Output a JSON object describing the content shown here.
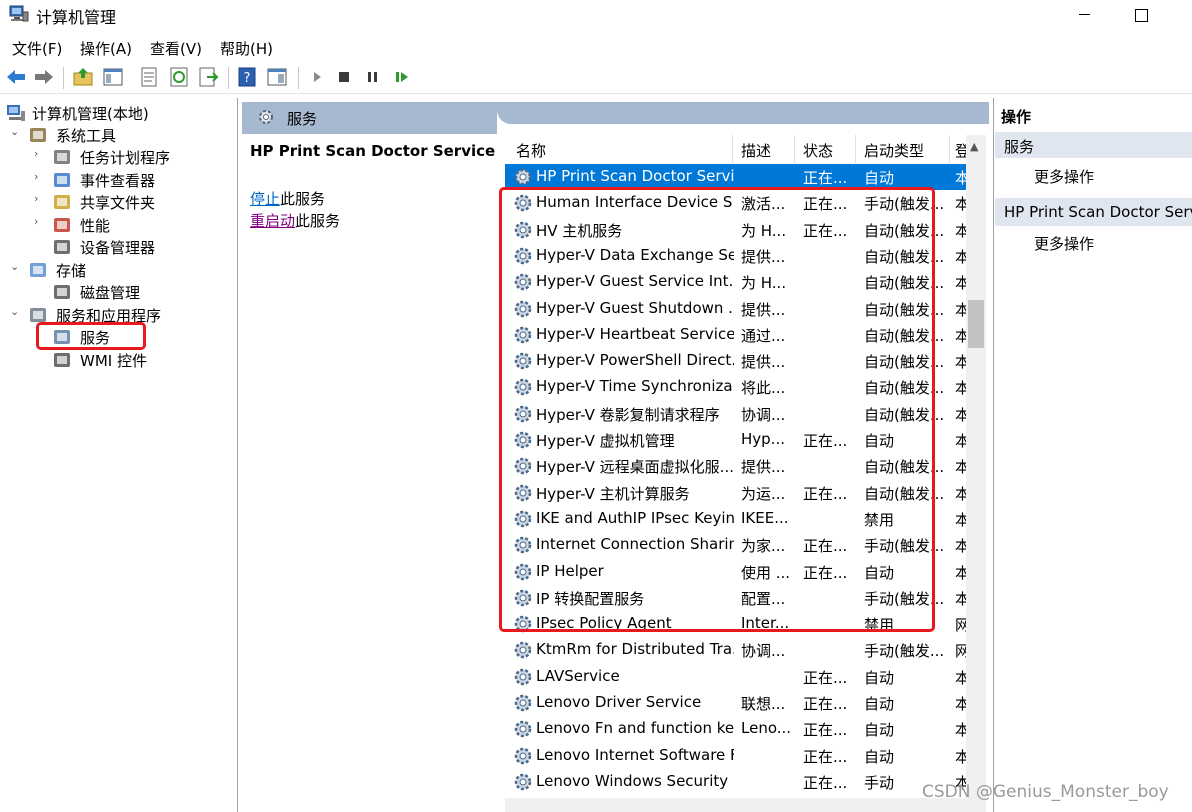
{
  "window": {
    "title": "计算机管理"
  },
  "menu": [
    "文件(F)",
    "操作(A)",
    "查看(V)",
    "帮助(H)"
  ],
  "toolbar_icons": [
    "back-arrow-icon",
    "forward-arrow-icon",
    "up-folder-icon",
    "show-tree-icon",
    "properties-icon",
    "refresh-icon",
    "export-icon",
    "help-icon",
    "action-pane-icon",
    "start-icon",
    "stop-icon",
    "pause-icon",
    "restart-icon"
  ],
  "tree": {
    "root": "计算机管理(本地)",
    "nodes": [
      {
        "label": "系统工具",
        "level": 1,
        "chev": "⌄"
      },
      {
        "label": "任务计划程序",
        "level": 2,
        "chev": "›"
      },
      {
        "label": "事件查看器",
        "level": 2,
        "chev": "›"
      },
      {
        "label": "共享文件夹",
        "level": 2,
        "chev": "›"
      },
      {
        "label": "性能",
        "level": 2,
        "chev": "›"
      },
      {
        "label": "设备管理器",
        "level": 2,
        "chev": ""
      },
      {
        "label": "存储",
        "level": 1,
        "chev": "⌄"
      },
      {
        "label": "磁盘管理",
        "level": 2,
        "chev": ""
      },
      {
        "label": "服务和应用程序",
        "level": 1,
        "chev": "⌄"
      },
      {
        "label": "服务",
        "level": 2,
        "chev": ""
      },
      {
        "label": "WMI 控件",
        "level": 2,
        "chev": ""
      }
    ]
  },
  "services_panel": {
    "header": "服务",
    "selected_name": "HP Print Scan Doctor Service",
    "stop_link": "停止",
    "stop_suffix": "此服务",
    "restart_link": "重启动",
    "restart_suffix": "此服务"
  },
  "columns": [
    "名称",
    "描述",
    "状态",
    "启动类型",
    "登"
  ],
  "rows": [
    [
      "HP Print Scan Doctor Service",
      "",
      "正在...",
      "自动",
      "本"
    ],
    [
      "Human Interface Device S...",
      "激活...",
      "正在...",
      "手动(触发...",
      "本"
    ],
    [
      "HV 主机服务",
      "为 H...",
      "正在...",
      "自动(触发...",
      "本"
    ],
    [
      "Hyper-V Data Exchange Se...",
      "提供...",
      "",
      "自动(触发...",
      "本"
    ],
    [
      "Hyper-V Guest Service Int...",
      "为 H...",
      "",
      "自动(触发...",
      "本"
    ],
    [
      "Hyper-V Guest Shutdown ...",
      "提供...",
      "",
      "自动(触发...",
      "本"
    ],
    [
      "Hyper-V Heartbeat Service",
      "通过...",
      "",
      "自动(触发...",
      "本"
    ],
    [
      "Hyper-V PowerShell Direct...",
      "提供...",
      "",
      "自动(触发...",
      "本"
    ],
    [
      "Hyper-V Time Synchroniza...",
      "将此...",
      "",
      "自动(触发...",
      "本"
    ],
    [
      "Hyper-V 卷影复制请求程序",
      "协调...",
      "",
      "自动(触发...",
      "本"
    ],
    [
      "Hyper-V 虚拟机管理",
      "Hyp...",
      "正在...",
      "自动",
      "本"
    ],
    [
      "Hyper-V 远程桌面虚拟化服...",
      "提供...",
      "",
      "自动(触发...",
      "本"
    ],
    [
      "Hyper-V 主机计算服务",
      "为运...",
      "正在...",
      "自动(触发...",
      "本"
    ],
    [
      "IKE and AuthIP IPsec Keyin...",
      "IKEE...",
      "",
      "禁用",
      "本"
    ],
    [
      "Internet Connection Sharin...",
      "为家...",
      "正在...",
      "手动(触发...",
      "本"
    ],
    [
      "IP Helper",
      "使用 ...",
      "正在...",
      "自动",
      "本"
    ],
    [
      "IP 转换配置服务",
      "配置...",
      "",
      "手动(触发...",
      "本"
    ],
    [
      "IPsec Policy Agent",
      "Inter...",
      "",
      "禁用",
      "网"
    ],
    [
      "KtmRm for Distributed Tra...",
      "协调...",
      "",
      "手动(触发...",
      "网"
    ],
    [
      "LAVService",
      "",
      "正在...",
      "自动",
      "本"
    ],
    [
      "Lenovo Driver Service",
      "联想...",
      "正在...",
      "自动",
      "本"
    ],
    [
      "Lenovo Fn and function ke...",
      "Leno...",
      "正在...",
      "自动",
      "本"
    ],
    [
      "Lenovo Internet Software F...",
      "",
      "正在...",
      "自动",
      "本"
    ],
    [
      "Lenovo Windows Security ...",
      "",
      "正在...",
      "手动",
      "本"
    ]
  ],
  "actions": {
    "title": "操作",
    "section1": "服务",
    "section1_more": "更多操作",
    "section2": "HP Print Scan Doctor Service",
    "section2_more": "更多操作"
  },
  "watermark": "CSDN @Genius_Monster_boy",
  "colors": {
    "selection": "#0078d7",
    "highlight": "#e8191f",
    "header": "#a6b9d1"
  }
}
